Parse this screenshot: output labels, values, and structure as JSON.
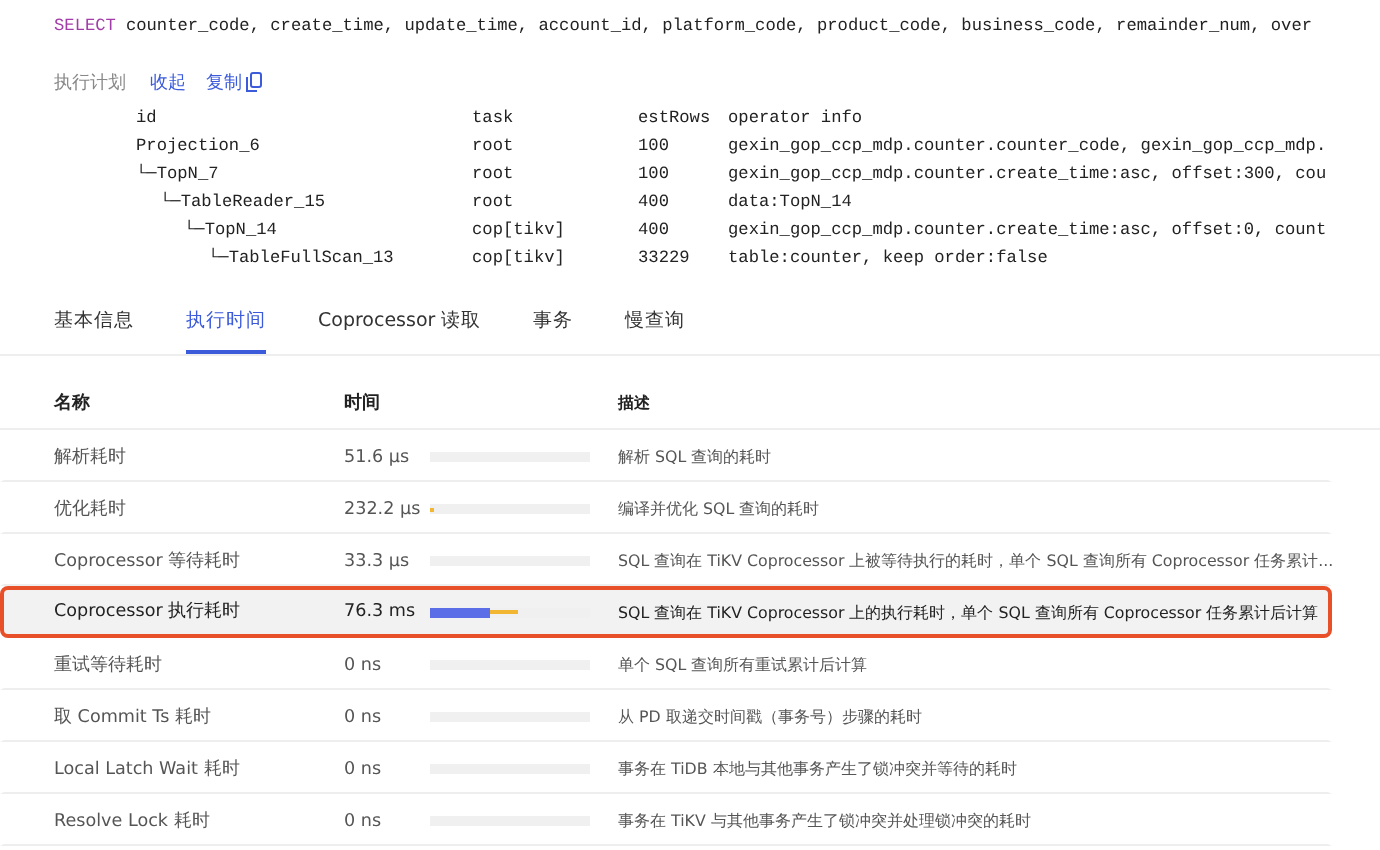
{
  "sql": {
    "keyword": "SELECT",
    "text": "counter_code, create_time, update_time, account_id, platform_code, product_code, business_code, remainder_num, over"
  },
  "plan_toolbar": {
    "label": "执行计划",
    "collapse_link": "收起",
    "copy_link": "复制"
  },
  "plan": {
    "columns": [
      "id",
      "task",
      "estRows",
      "operator info"
    ],
    "rows": [
      {
        "id": "Projection_6",
        "task": "root",
        "estRows": "100",
        "info": "gexin_gop_ccp_mdp.counter.counter_code, gexin_gop_ccp_mdp.",
        "children": [
          {
            "id": "└─TopN_7",
            "task": "root",
            "estRows": "100",
            "info": "gexin_gop_ccp_mdp.counter.create_time:asc, offset:300, cou",
            "children": [
              {
                "id": "└─TableReader_15",
                "task": "root",
                "estRows": "400",
                "info": "data:TopN_14",
                "children": [
                  {
                    "id": "└─TopN_14",
                    "task": "cop[tikv]",
                    "estRows": "400",
                    "info": "gexin_gop_ccp_mdp.counter.create_time:asc, offset:0, count",
                    "children": [
                      {
                        "id": "└─TableFullScan_13",
                        "task": "cop[tikv]",
                        "estRows": "33229",
                        "info": "table:counter, keep order:false"
                      }
                    ]
                  }
                ]
              }
            ]
          }
        ]
      }
    ]
  },
  "tabs": [
    {
      "label": "基本信息",
      "selected": false
    },
    {
      "label": "执行时间",
      "selected": true
    },
    {
      "label": "Coprocessor 读取",
      "selected": false
    },
    {
      "label": "事务",
      "selected": false
    },
    {
      "label": "慢查询",
      "selected": false
    }
  ],
  "table": {
    "columns": [
      "名称",
      "时间",
      "描述"
    ],
    "rows": [
      {
        "name": "解析耗时",
        "time": "51.6 µs",
        "bar": null,
        "whisker": null,
        "description": "解析 SQL 查询的耗时",
        "selected": false
      },
      {
        "name": "优化耗时",
        "time": "232.2 µs",
        "bar": null,
        "whisker": {
          "level": 0.02
        },
        "description": "编译并优化 SQL 查询的耗时",
        "selected": false
      },
      {
        "name": "Coprocessor 等待耗时",
        "time": "33.3 µs",
        "bar": null,
        "whisker": null,
        "description": "SQL 查询在 TiKV Coprocessor 上被等待执行的耗时，单个 SQL 查询所有 Coprocessor 任务累计...",
        "selected": false
      },
      {
        "name": "Coprocessor 执行耗时",
        "time": "76.3 ms",
        "bar": {
          "level": 0.38
        },
        "whisker": {
          "level": 0.55
        },
        "description": "SQL 查询在 TiKV Coprocessor 上的执行耗时，单个 SQL 查询所有 Coprocessor 任务累计后计算",
        "selected": true
      },
      {
        "name": "重试等待耗时",
        "time": "0 ns",
        "bar": null,
        "whisker": null,
        "description": "单个 SQL 查询所有重试累计后计算",
        "selected": false
      },
      {
        "name": "取 Commit Ts 耗时",
        "time": "0 ns",
        "bar": null,
        "whisker": null,
        "description": "从 PD 取递交时间戳（事务号）步骤的耗时",
        "selected": false
      },
      {
        "name": "Local Latch Wait 耗时",
        "time": "0 ns",
        "bar": null,
        "whisker": null,
        "description": "事务在 TiDB 本地与其他事务产生了锁冲突并等待的耗时",
        "selected": false
      },
      {
        "name": "Resolve Lock 耗时",
        "time": "0 ns",
        "bar": null,
        "whisker": null,
        "description": "事务在 TiKV 与其他事务产生了锁冲突并处理锁冲突的耗时",
        "selected": false
      }
    ]
  }
}
